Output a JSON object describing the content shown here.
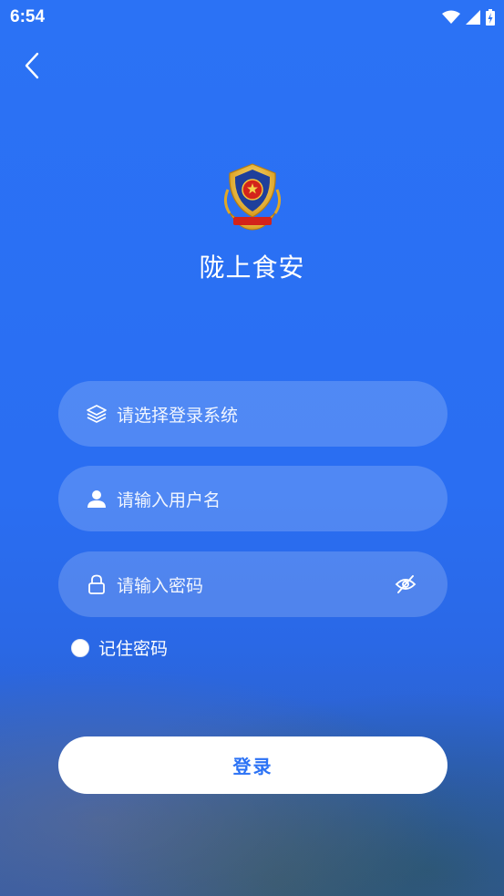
{
  "status_bar": {
    "time": "6:54"
  },
  "app": {
    "title": "陇上食安"
  },
  "form": {
    "system_placeholder": "请选择登录系统",
    "username_placeholder": "请输入用户名",
    "password_placeholder": "请输入密码",
    "remember_label": "记住密码",
    "login_label": "登录"
  },
  "icons": {
    "back": "chevron-left",
    "system": "layers",
    "user": "person",
    "password": "lock",
    "toggle_visibility": "eye-off"
  },
  "colors": {
    "accent": "#2b72f5",
    "button_bg": "#ffffff"
  }
}
